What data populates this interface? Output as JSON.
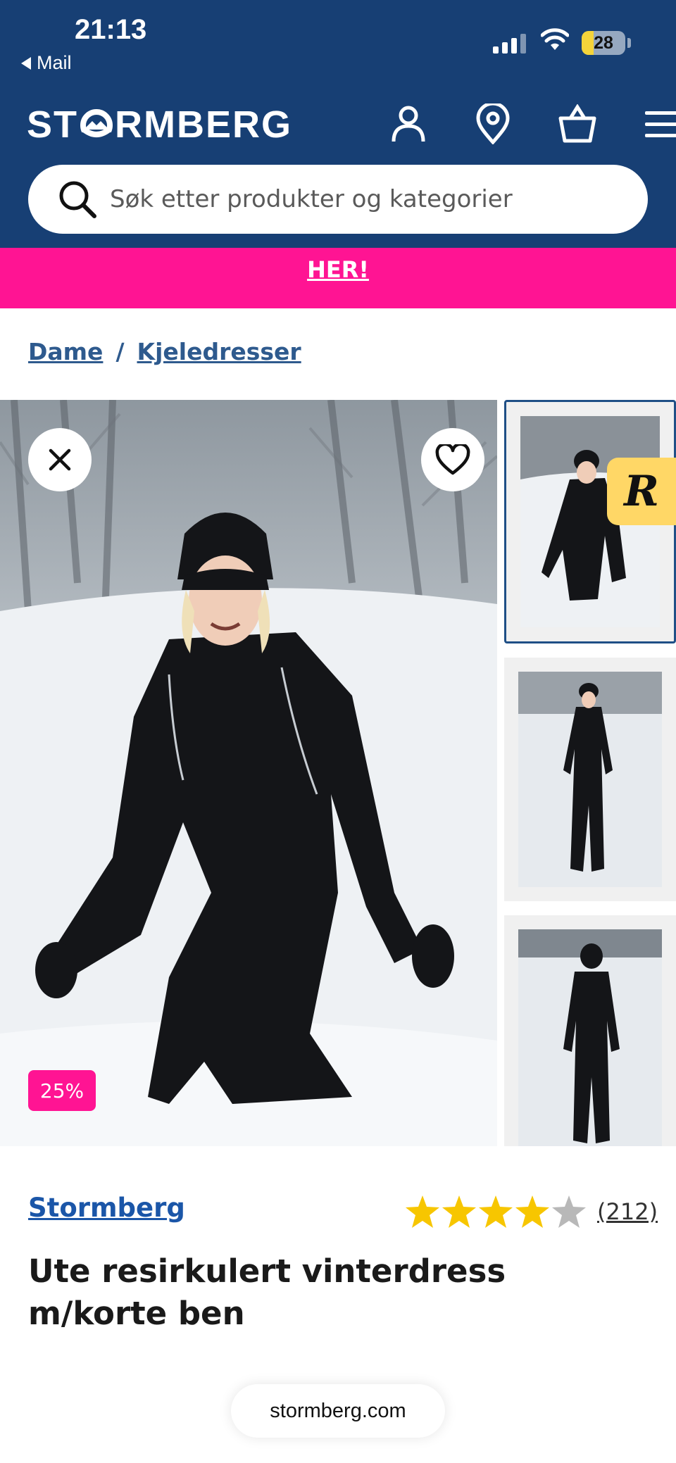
{
  "status_bar": {
    "time": "21:13",
    "back_label": "Mail",
    "battery": "28",
    "battery_level": 0.28
  },
  "header": {
    "logo_text_left": "ST",
    "logo_text_right": "RMBERG",
    "icons": [
      "account-icon",
      "location-pin-icon",
      "shopping-bag-icon",
      "hamburger-menu-icon"
    ],
    "brand_color": "#173f74"
  },
  "search": {
    "placeholder": "Søk etter produkter og kategorier"
  },
  "promo": {
    "link_text": "HER!",
    "color": "#ff1493"
  },
  "breadcrumb": {
    "items": [
      "Dame",
      "Kjeledresser"
    ],
    "separator": "/"
  },
  "gallery": {
    "discount_badge": "25%",
    "thumbnails": 3,
    "selected_thumbnail": 1
  },
  "product": {
    "brand": "Stormberg",
    "rating": 4,
    "rating_max": 5,
    "review_count": "(212)",
    "title": "Ute resirkulert vinterdress m/korte ben"
  },
  "browser": {
    "url": "stormberg.com"
  }
}
